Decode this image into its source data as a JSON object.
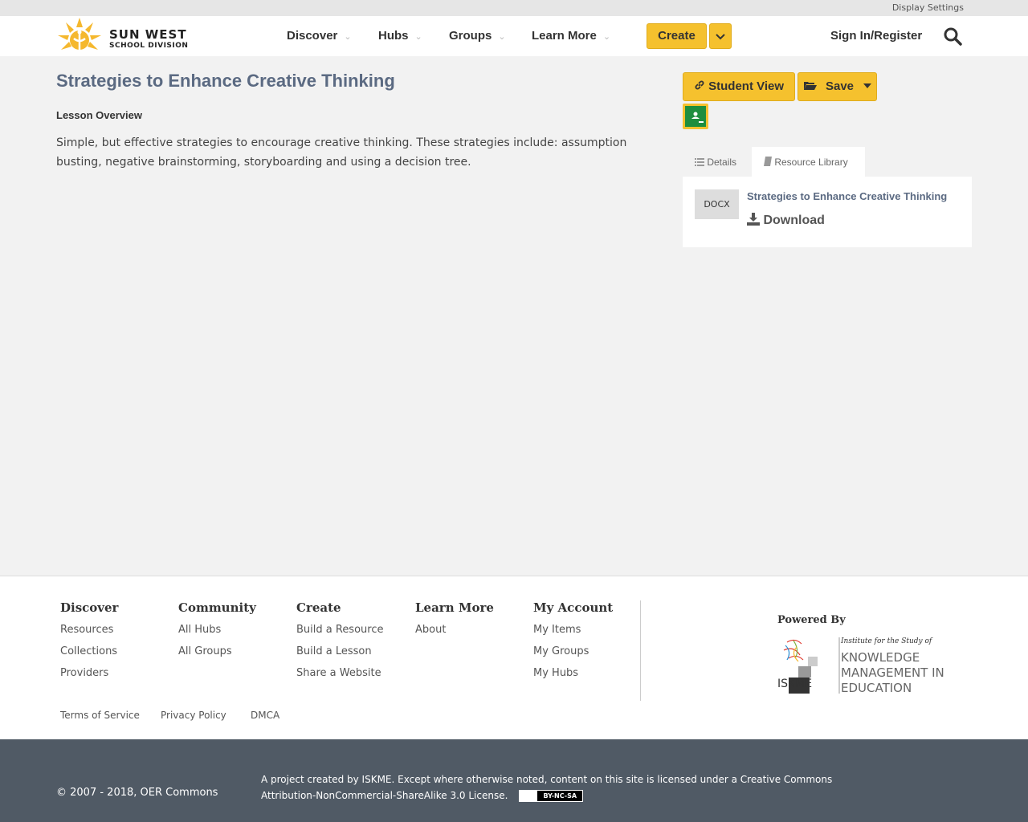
{
  "utility": {
    "display_settings": "Display Settings"
  },
  "header": {
    "logo_line1": "SUN WEST",
    "logo_line2": "SCHOOL DIVISION",
    "nav": [
      "Discover",
      "Hubs",
      "Groups",
      "Learn More"
    ],
    "create": "Create",
    "signin": "Sign In/Register"
  },
  "lesson": {
    "title": "Strategies to Enhance Creative Thinking",
    "overview_label": "Lesson Overview",
    "overview_text": "Simple, but effective strategies to encourage creative thinking. These strategies include: assumption busting, negative brainstorming, storyboarding and using a decision tree."
  },
  "actions": {
    "student_view": "Student View",
    "save": "Save"
  },
  "tabs": {
    "details": "Details",
    "resource_library": "Resource Library"
  },
  "resource": {
    "type": "DOCX",
    "title": "Strategies to Enhance Creative Thinking",
    "download": "Download"
  },
  "footer": {
    "columns": [
      {
        "heading": "Discover",
        "links": [
          "Resources",
          "Collections",
          "Providers"
        ]
      },
      {
        "heading": "Community",
        "links": [
          "All Hubs",
          "All Groups"
        ]
      },
      {
        "heading": "Create",
        "links": [
          "Build a Resource",
          "Build a Lesson",
          "Share a Website"
        ]
      },
      {
        "heading": "Learn More",
        "links": [
          "About"
        ]
      },
      {
        "heading": "My Account",
        "links": [
          "My Items",
          "My Groups",
          "My Hubs"
        ]
      }
    ],
    "powered_by": "Powered By",
    "iskme_tagline": "Institute for the Study of",
    "iskme_line1": "KNOWLEDGE",
    "iskme_line2": "MANAGEMENT IN",
    "iskme_line3": "EDUCATION",
    "iskme_word": "ISKME",
    "legal": [
      "Terms of Service",
      "Privacy Policy",
      "DMCA"
    ]
  },
  "bottom": {
    "copyright": "© 2007 - 2018, OER Commons",
    "license": "A project created by ISKME. Except where otherwise noted, content on this site is licensed under a Creative Commons Attribution-NonCommercial-ShareAlike 3.0 License.",
    "cc_badge": "BY-NC-SA"
  },
  "colors": {
    "accent": "#f5c12e",
    "title": "#5b6a82",
    "footer_dark": "#505a65"
  }
}
